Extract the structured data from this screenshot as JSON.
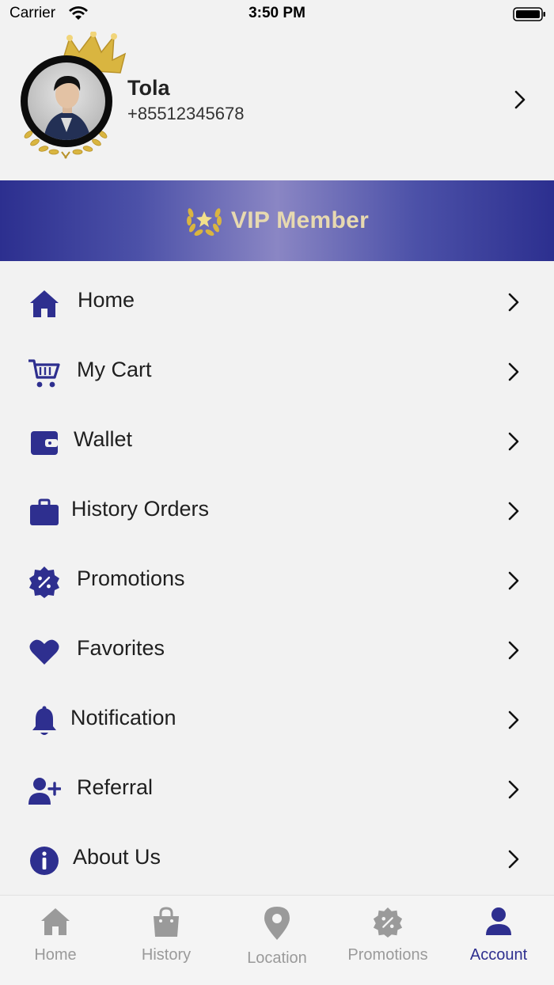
{
  "status_bar": {
    "carrier": "Carrier",
    "time": "3:50 PM"
  },
  "profile": {
    "name": "Tola",
    "phone": "+85512345678"
  },
  "vip": {
    "label": "VIP Member"
  },
  "menu": {
    "items": [
      {
        "label": "Home",
        "icon": "home-icon"
      },
      {
        "label": "My Cart",
        "icon": "cart-icon"
      },
      {
        "label": "Wallet",
        "icon": "wallet-icon"
      },
      {
        "label": "History Orders",
        "icon": "briefcase-icon"
      },
      {
        "label": "Promotions",
        "icon": "promotion-badge-icon"
      },
      {
        "label": "Favorites",
        "icon": "heart-icon"
      },
      {
        "label": "Notification",
        "icon": "bell-icon"
      },
      {
        "label": "Referral",
        "icon": "add-user-icon"
      },
      {
        "label": "About Us",
        "icon": "info-icon"
      }
    ]
  },
  "tabbar": {
    "active": "Account",
    "tabs": [
      {
        "label": "Home",
        "icon": "home-icon"
      },
      {
        "label": "History",
        "icon": "shopping-bag-icon"
      },
      {
        "label": "Location",
        "icon": "location-pin-icon"
      },
      {
        "label": "Promotions",
        "icon": "promotion-badge-icon"
      },
      {
        "label": "Account",
        "icon": "account-icon"
      }
    ]
  },
  "colors": {
    "primary": "#2e2f8f",
    "inactive": "#9a9a9a",
    "background": "#f2f2f2",
    "gold": "#d8b440"
  }
}
